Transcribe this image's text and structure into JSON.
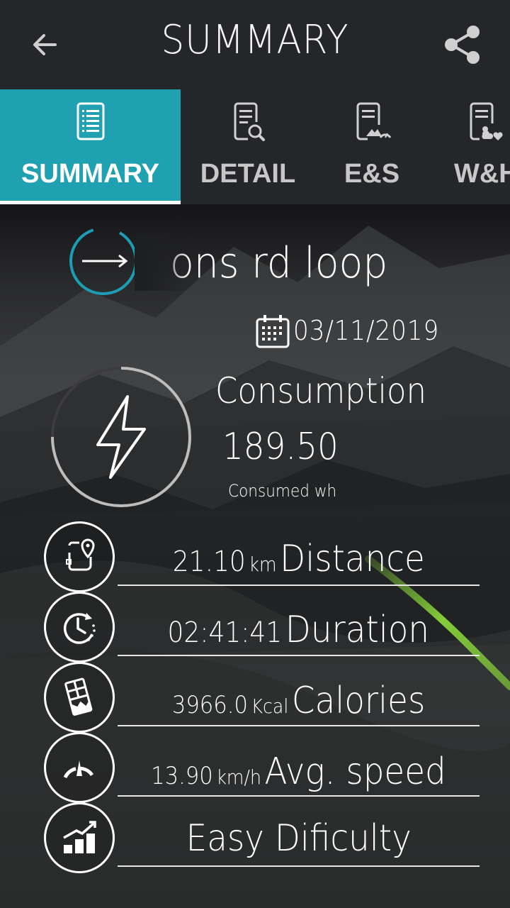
{
  "appbar": {
    "title": "SUMMARY",
    "back_icon": "arrow-left-icon",
    "share_icon": "share-icon"
  },
  "tabs": [
    {
      "label": "SUMMARY",
      "icon": "list-document-icon",
      "active": true
    },
    {
      "label": "DETAIL",
      "icon": "document-search-icon",
      "active": false
    },
    {
      "label": "E&S",
      "icon": "document-elevation-speed-icon",
      "active": false
    },
    {
      "label": "W&H",
      "icon": "document-weather-heart-icon",
      "active": false
    }
  ],
  "route": {
    "name": "ons rd loop",
    "icon": "route-arrow-icon"
  },
  "date": "03/11/2019",
  "consumption": {
    "title": "Consumption",
    "value": "189.50",
    "unit": "Consumed wh",
    "progress": 0.75
  },
  "stats": [
    {
      "value": "21.10",
      "unit": "km",
      "name": "Distance",
      "icon": "map-pin-route-icon"
    },
    {
      "value": "02:41:41",
      "unit": "",
      "name": "Duration",
      "icon": "stopwatch-icon"
    },
    {
      "value": "3966.0",
      "unit": "Kcal",
      "name": "Calories",
      "icon": "chocolate-bar-icon"
    },
    {
      "value": "13.90",
      "unit": "km/h",
      "name": "Avg. speed",
      "icon": "speedometer-icon"
    },
    {
      "value": "",
      "unit": "",
      "name": "Easy Dificulty",
      "icon": "bar-chart-icon"
    }
  ],
  "colors": {
    "accent": "#20a1b2",
    "appbar": "#25262a",
    "trail": "#8fe03c"
  }
}
